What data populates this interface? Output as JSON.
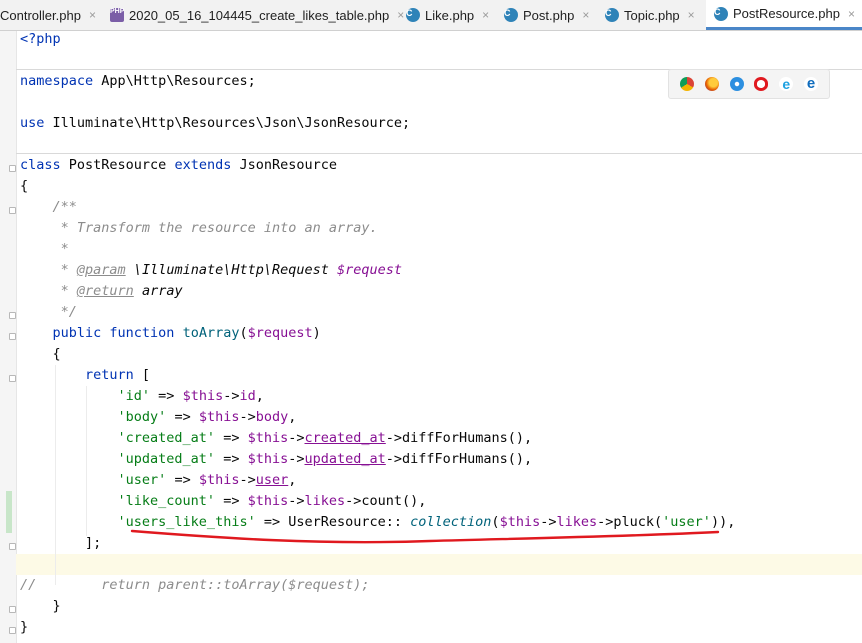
{
  "tabs": [
    {
      "label": "Controller.php",
      "icon": "php-class-icon"
    },
    {
      "label": "2020_05_16_104445_create_likes_table.php",
      "icon": "php-file-icon"
    },
    {
      "label": "Like.php",
      "icon": "php-class-icon"
    },
    {
      "label": "Post.php",
      "icon": "php-class-icon"
    },
    {
      "label": "Topic.php",
      "icon": "php-class-icon"
    },
    {
      "label": "PostResource.php",
      "icon": "php-class-icon",
      "active": true
    }
  ],
  "close_glyph": "×",
  "browser_icons": [
    "chrome-icon",
    "firefox-icon",
    "safari-icon",
    "opera-icon",
    "ie-icon",
    "edge-icon"
  ],
  "annotation_color": "#e0191f",
  "code": {
    "l1": "<?php",
    "l3a": "namespace",
    "l3b": " App\\Http\\Resources;",
    "l5a": "use",
    "l5b": " Illuminate\\Http\\Resources\\Json\\JsonResource;",
    "l7a": "class",
    "l7b": " PostResource ",
    "l7c": "extends",
    "l7d": " JsonResource",
    "l8": "{",
    "l9": "    /**",
    "l10": "     * Transform the resource into an array.",
    "l11": "     *",
    "l12a": "     * ",
    "l12b": "@param",
    "l12c": " \\Illuminate\\Http\\Request ",
    "l12d": "$request",
    "l13a": "     * ",
    "l13b": "@return",
    "l13c": " array",
    "l14": "     */",
    "l15a": "    public function ",
    "l15b": "toArray",
    "l15c": "(",
    "l15d": "$request",
    "l15e": ")",
    "l16": "    {",
    "l17a": "        return",
    "l17b": " [",
    "l18a": "            'id'",
    "l18b": " => ",
    "l18c": "$this",
    "l18d": "->",
    "l18e": "id",
    "l18f": ",",
    "l19a": "            'body'",
    "l19b": " => ",
    "l19c": "$this",
    "l19d": "->",
    "l19e": "body",
    "l19f": ",",
    "l20a": "            'created_at'",
    "l20b": " => ",
    "l20c": "$this",
    "l20d": "->",
    "l20e": "created_at",
    "l20f": "->",
    "l20g": "diffForHumans",
    "l20h": "(),",
    "l21a": "            'updated_at'",
    "l21b": " => ",
    "l21c": "$this",
    "l21d": "->",
    "l21e": "updated_at",
    "l21f": "->",
    "l21g": "diffForHumans",
    "l21h": "(),",
    "l22a": "            'user'",
    "l22b": " => ",
    "l22c": "$this",
    "l22d": "->",
    "l22e": "user",
    "l22f": ",",
    "l23a": "            'like_count'",
    "l23b": " => ",
    "l23c": "$this",
    "l23d": "->",
    "l23e": "likes",
    "l23f": "->",
    "l23g": "count",
    "l23h": "(),",
    "l24a": "            'users_like_this'",
    "l24b": " => UserResource:: ",
    "l24c": "collection",
    "l24d": "(",
    "l24e": "$this",
    "l24f": "->",
    "l24g": "likes",
    "l24h": "->",
    "l24i": "pluck",
    "l24j": "(",
    "l24k": "'user'",
    "l24l": ")),",
    "l25": "        ];",
    "l27a": "//",
    "l27b": "        return parent::toArray($request);",
    "l28": "    }",
    "l29": "}"
  }
}
